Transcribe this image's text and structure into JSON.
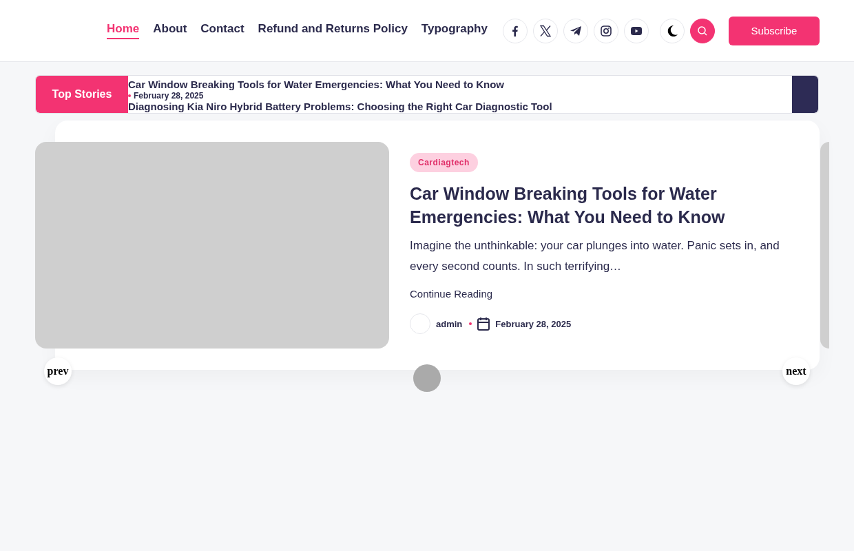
{
  "nav": [
    {
      "label": "Home",
      "selected": true
    },
    {
      "label": "About",
      "selected": false
    },
    {
      "label": "Contact",
      "selected": false
    },
    {
      "label": "Refund and Returns Policy",
      "selected": false
    },
    {
      "label": "Typography",
      "selected": false
    }
  ],
  "social": [
    {
      "kind": "facebook"
    },
    {
      "kind": "x"
    },
    {
      "kind": "telegram"
    },
    {
      "kind": "instagram"
    },
    {
      "kind": "youtube"
    }
  ],
  "subscribe": "Subscribe",
  "ticker": {
    "label": "Top Stories",
    "items": [
      {
        "title": "Car Window Breaking Tools for Water Emergencies: What You Need to Know",
        "date": "February 28, 2025"
      },
      {
        "title": "Diagnosing Kia Niro Hybrid Battery Problems: Choosing the Right Car Diagnostic Tool"
      }
    ]
  },
  "slide": {
    "category": "Cardiagtech",
    "title": "Car Window Breaking Tools for Water Emergencies: What You Need to Know",
    "excerpt": "Imagine the unthinkable: your car plunges into water. Panic sets in, and every second counts. In such terrifying…",
    "more": "Continue Reading",
    "author": "admin",
    "date": "February 28, 2025"
  },
  "slider": {
    "prev": "prev",
    "next": "next",
    "dots": [
      {
        "selected": false
      }
    ]
  }
}
